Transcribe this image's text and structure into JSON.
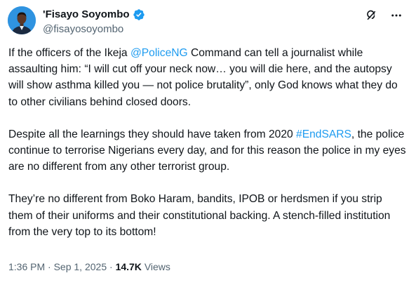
{
  "author": {
    "display_name": "'Fisayo Soyombo",
    "handle": "@fisayosoyombo",
    "verified": true
  },
  "actions": {
    "grok_icon": "grok-icon",
    "more_icon": "more-icon"
  },
  "tweet": {
    "paragraphs": [
      {
        "segments": [
          {
            "type": "text",
            "text": "If the officers of the Ikeja "
          },
          {
            "type": "mention",
            "text": "@PoliceNG"
          },
          {
            "type": "text",
            "text": " Command can tell a journalist while assaulting him: “I will cut off your neck now… you will die here, and the autopsy will show asthma killed you — not police brutality”, only God knows what they do to other civilians behind closed doors."
          }
        ]
      },
      {
        "segments": [
          {
            "type": "text",
            "text": "Despite all the learnings they should have taken from 2020 "
          },
          {
            "type": "hashtag",
            "text": "#EndSARS"
          },
          {
            "type": "text",
            "text": ", the police continue to terrorise Nigerians every day, and for this reason the police in my eyes are no different from any other terrorist group."
          }
        ]
      },
      {
        "segments": [
          {
            "type": "text",
            "text": "They’re no different from Boko Haram, bandits, IPOB or herdsmen if you strip them of their uniforms and their constitutional backing. A stench-filled institution from the very top to its bottom!"
          }
        ]
      }
    ]
  },
  "meta": {
    "time": "1:36 PM",
    "separator": " · ",
    "date": "Sep 1, 2025",
    "views_count": "14.7K",
    "views_label": "Views"
  },
  "colors": {
    "link": "#1d9bf0",
    "text": "#0f1419",
    "secondary": "#536471",
    "verified": "#1d9bf0"
  }
}
